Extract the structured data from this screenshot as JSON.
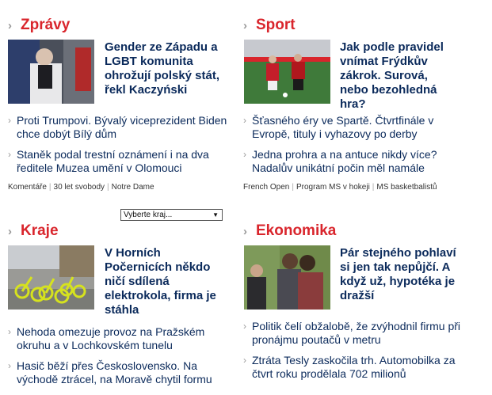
{
  "sections": {
    "zpravy": {
      "title": "Zprávy",
      "lead": "Gender ze Západu a LGBT komunita ohrožují polský stát, řekl Kaczyński",
      "items": [
        "Proti Trumpovi. Bývalý viceprezident Biden chce dobýt Bílý dům",
        "Staněk podal trestní oznámení i na dva ředitele Muzea umění v Olomouci"
      ],
      "tags": [
        "Komentáře",
        "30 let svobody",
        "Notre Dame"
      ]
    },
    "sport": {
      "title": "Sport",
      "lead": "Jak podle pravidel vnímat Frýdkův zákrok. Surová, nebo bezohledná hra?",
      "items": [
        "Šťasného éry ve Spartě. Čtvrtfinále v Evropě, tituly i vyhazovy po derby",
        "Jedna prohra a na antuce nikdy více? Nadalův unikátní počin měl namále"
      ],
      "tags": [
        "French Open",
        "Program MS v hokeji",
        "MS basketbalistů"
      ]
    },
    "kraje": {
      "title": "Kraje",
      "lead": "V Horních Počernicích někdo ničí sdílená elektrokola, firma je stáhla",
      "items": [
        "Nehoda omezuje provoz na Pražském okruhu a v Lochkovském tunelu",
        "Hasič běží přes Československo. Na východě ztrácel, na Moravě chytil formu"
      ]
    },
    "ekonomika": {
      "title": "Ekonomika",
      "lead": "Pár stejného pohlaví si jen tak nepůjčí. A když už, hypotéka je dražší",
      "items": [
        "Politik čelí obžalobě, že zvýhodnil firmu při pronájmu poutačů v metru",
        "Ztráta Tesly zaskočila trh. Automobilka za čtvrt roku prodělala 702 milionů"
      ]
    }
  },
  "region_select": {
    "value": "Vyberte kraj..."
  },
  "icons": {
    "chevron": "chevron-right-icon",
    "dropdown": "dropdown-arrow-icon"
  },
  "colors": {
    "section_title": "#d9252c",
    "link": "#0b2a5b"
  }
}
